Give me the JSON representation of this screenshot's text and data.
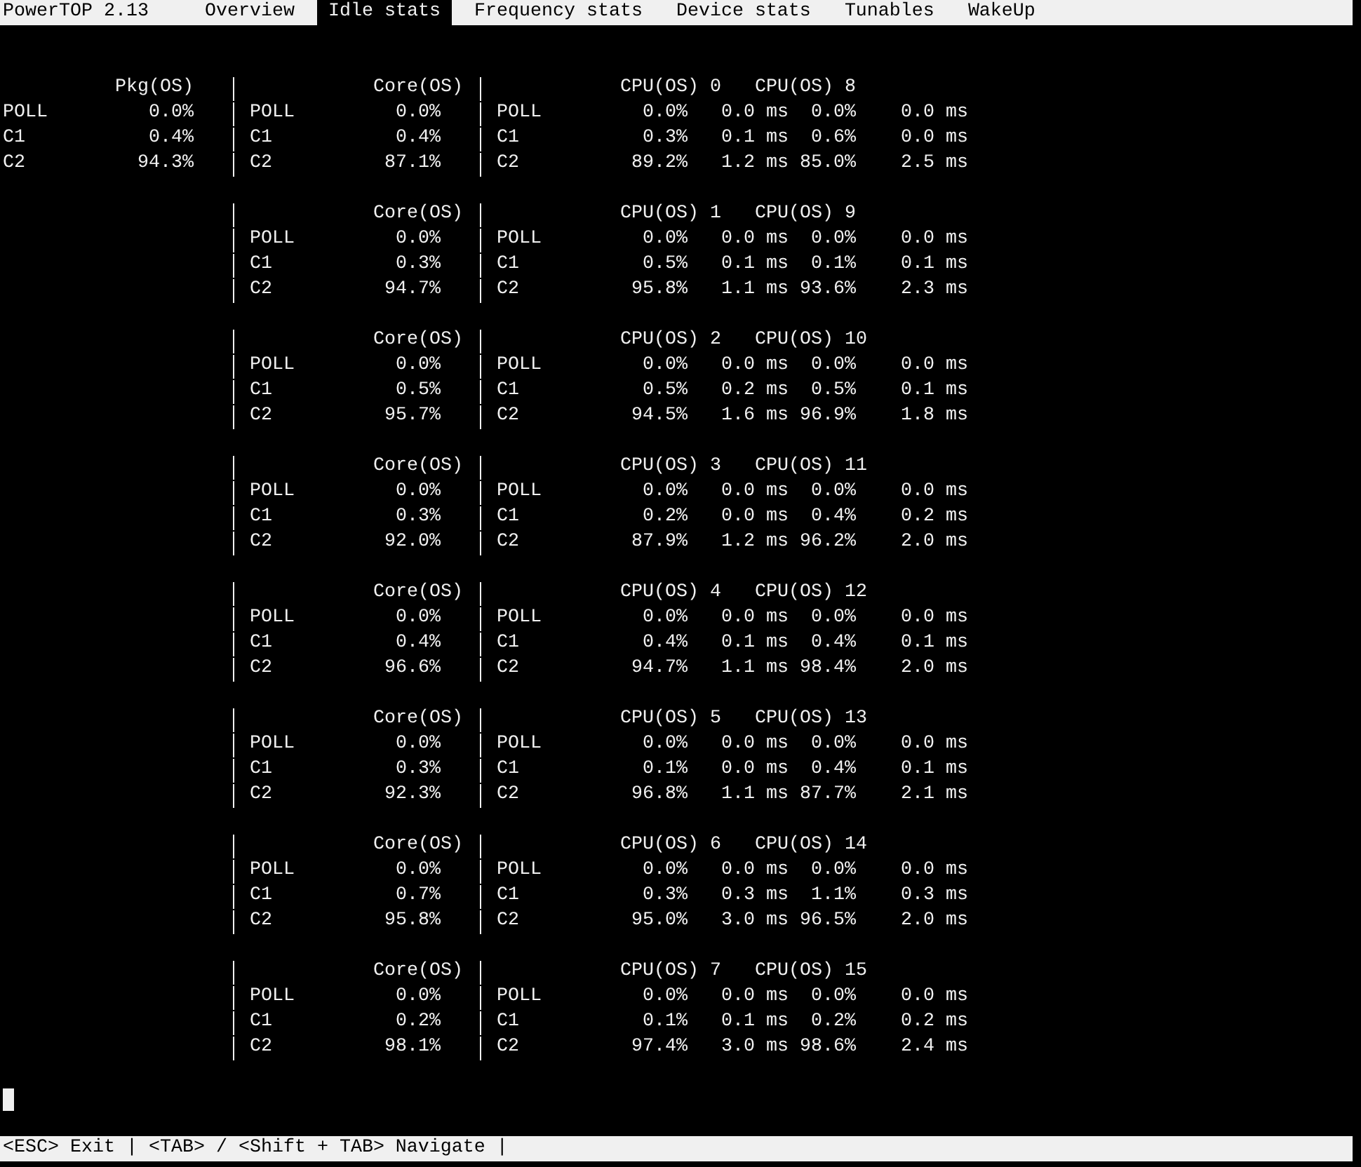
{
  "title": "PowerTOP 2.13",
  "tabs": [
    {
      "label": "Overview",
      "selected": false
    },
    {
      "label": "Idle stats",
      "selected": true
    },
    {
      "label": "Frequency stats",
      "selected": false
    },
    {
      "label": "Device stats",
      "selected": false
    },
    {
      "label": "Tunables",
      "selected": false
    },
    {
      "label": "WakeUp",
      "selected": false
    }
  ],
  "package": {
    "header": "Pkg(OS)",
    "rows": [
      {
        "state": "POLL",
        "value": "0.0%"
      },
      {
        "state": "C1",
        "value": "0.4%"
      },
      {
        "state": "C2",
        "value": "94.3%"
      }
    ]
  },
  "cores": [
    {
      "header": "Core(OS)",
      "cpu_headers": [
        "CPU(OS) 0",
        "CPU(OS) 8"
      ],
      "rows": [
        {
          "core_state": "POLL",
          "core": "0.0%",
          "cpu_state": "POLL",
          "cpu_a": "0.0%",
          "time_a": "0.0 ms",
          "cpu_b": "0.0%",
          "time_b": "0.0 ms"
        },
        {
          "core_state": "C1",
          "core": "0.4%",
          "cpu_state": "C1",
          "cpu_a": "0.3%",
          "time_a": "0.1 ms",
          "cpu_b": "0.6%",
          "time_b": "0.0 ms"
        },
        {
          "core_state": "C2",
          "core": "87.1%",
          "cpu_state": "C2",
          "cpu_a": "89.2%",
          "time_a": "1.2 ms",
          "cpu_b": "85.0%",
          "time_b": "2.5 ms"
        }
      ]
    },
    {
      "header": "Core(OS)",
      "cpu_headers": [
        "CPU(OS) 1",
        "CPU(OS) 9"
      ],
      "rows": [
        {
          "core_state": "POLL",
          "core": "0.0%",
          "cpu_state": "POLL",
          "cpu_a": "0.0%",
          "time_a": "0.0 ms",
          "cpu_b": "0.0%",
          "time_b": "0.0 ms"
        },
        {
          "core_state": "C1",
          "core": "0.3%",
          "cpu_state": "C1",
          "cpu_a": "0.5%",
          "time_a": "0.1 ms",
          "cpu_b": "0.1%",
          "time_b": "0.1 ms"
        },
        {
          "core_state": "C2",
          "core": "94.7%",
          "cpu_state": "C2",
          "cpu_a": "95.8%",
          "time_a": "1.1 ms",
          "cpu_b": "93.6%",
          "time_b": "2.3 ms"
        }
      ]
    },
    {
      "header": "Core(OS)",
      "cpu_headers": [
        "CPU(OS) 2",
        "CPU(OS) 10"
      ],
      "rows": [
        {
          "core_state": "POLL",
          "core": "0.0%",
          "cpu_state": "POLL",
          "cpu_a": "0.0%",
          "time_a": "0.0 ms",
          "cpu_b": "0.0%",
          "time_b": "0.0 ms"
        },
        {
          "core_state": "C1",
          "core": "0.5%",
          "cpu_state": "C1",
          "cpu_a": "0.5%",
          "time_a": "0.2 ms",
          "cpu_b": "0.5%",
          "time_b": "0.1 ms"
        },
        {
          "core_state": "C2",
          "core": "95.7%",
          "cpu_state": "C2",
          "cpu_a": "94.5%",
          "time_a": "1.6 ms",
          "cpu_b": "96.9%",
          "time_b": "1.8 ms"
        }
      ]
    },
    {
      "header": "Core(OS)",
      "cpu_headers": [
        "CPU(OS) 3",
        "CPU(OS) 11"
      ],
      "rows": [
        {
          "core_state": "POLL",
          "core": "0.0%",
          "cpu_state": "POLL",
          "cpu_a": "0.0%",
          "time_a": "0.0 ms",
          "cpu_b": "0.0%",
          "time_b": "0.0 ms"
        },
        {
          "core_state": "C1",
          "core": "0.3%",
          "cpu_state": "C1",
          "cpu_a": "0.2%",
          "time_a": "0.0 ms",
          "cpu_b": "0.4%",
          "time_b": "0.2 ms"
        },
        {
          "core_state": "C2",
          "core": "92.0%",
          "cpu_state": "C2",
          "cpu_a": "87.9%",
          "time_a": "1.2 ms",
          "cpu_b": "96.2%",
          "time_b": "2.0 ms"
        }
      ]
    },
    {
      "header": "Core(OS)",
      "cpu_headers": [
        "CPU(OS) 4",
        "CPU(OS) 12"
      ],
      "rows": [
        {
          "core_state": "POLL",
          "core": "0.0%",
          "cpu_state": "POLL",
          "cpu_a": "0.0%",
          "time_a": "0.0 ms",
          "cpu_b": "0.0%",
          "time_b": "0.0 ms"
        },
        {
          "core_state": "C1",
          "core": "0.4%",
          "cpu_state": "C1",
          "cpu_a": "0.4%",
          "time_a": "0.1 ms",
          "cpu_b": "0.4%",
          "time_b": "0.1 ms"
        },
        {
          "core_state": "C2",
          "core": "96.6%",
          "cpu_state": "C2",
          "cpu_a": "94.7%",
          "time_a": "1.1 ms",
          "cpu_b": "98.4%",
          "time_b": "2.0 ms"
        }
      ]
    },
    {
      "header": "Core(OS)",
      "cpu_headers": [
        "CPU(OS) 5",
        "CPU(OS) 13"
      ],
      "rows": [
        {
          "core_state": "POLL",
          "core": "0.0%",
          "cpu_state": "POLL",
          "cpu_a": "0.0%",
          "time_a": "0.0 ms",
          "cpu_b": "0.0%",
          "time_b": "0.0 ms"
        },
        {
          "core_state": "C1",
          "core": "0.3%",
          "cpu_state": "C1",
          "cpu_a": "0.1%",
          "time_a": "0.0 ms",
          "cpu_b": "0.4%",
          "time_b": "0.1 ms"
        },
        {
          "core_state": "C2",
          "core": "92.3%",
          "cpu_state": "C2",
          "cpu_a": "96.8%",
          "time_a": "1.1 ms",
          "cpu_b": "87.7%",
          "time_b": "2.1 ms"
        }
      ]
    },
    {
      "header": "Core(OS)",
      "cpu_headers": [
        "CPU(OS) 6",
        "CPU(OS) 14"
      ],
      "rows": [
        {
          "core_state": "POLL",
          "core": "0.0%",
          "cpu_state": "POLL",
          "cpu_a": "0.0%",
          "time_a": "0.0 ms",
          "cpu_b": "0.0%",
          "time_b": "0.0 ms"
        },
        {
          "core_state": "C1",
          "core": "0.7%",
          "cpu_state": "C1",
          "cpu_a": "0.3%",
          "time_a": "0.3 ms",
          "cpu_b": "1.1%",
          "time_b": "0.3 ms"
        },
        {
          "core_state": "C2",
          "core": "95.8%",
          "cpu_state": "C2",
          "cpu_a": "95.0%",
          "time_a": "3.0 ms",
          "cpu_b": "96.5%",
          "time_b": "2.0 ms"
        }
      ]
    },
    {
      "header": "Core(OS)",
      "cpu_headers": [
        "CPU(OS) 7",
        "CPU(OS) 15"
      ],
      "rows": [
        {
          "core_state": "POLL",
          "core": "0.0%",
          "cpu_state": "POLL",
          "cpu_a": "0.0%",
          "time_a": "0.0 ms",
          "cpu_b": "0.0%",
          "time_b": "0.0 ms"
        },
        {
          "core_state": "C1",
          "core": "0.2%",
          "cpu_state": "C1",
          "cpu_a": "0.1%",
          "time_a": "0.1 ms",
          "cpu_b": "0.2%",
          "time_b": "0.2 ms"
        },
        {
          "core_state": "C2",
          "core": "98.1%",
          "cpu_state": "C2",
          "cpu_a": "97.4%",
          "time_a": "3.0 ms",
          "cpu_b": "98.6%",
          "time_b": "2.4 ms"
        }
      ]
    }
  ],
  "status_bar": "<ESC> Exit | <TAB> / <Shift + TAB> Navigate |"
}
